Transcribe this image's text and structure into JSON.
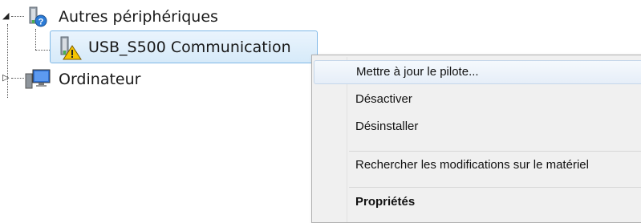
{
  "tree": {
    "nodes": [
      {
        "label": "Autres périphériques",
        "icon": "unknown-device-icon",
        "expanded": true
      },
      {
        "label": "USB_S500 Communication",
        "icon": "device-warning-icon",
        "selected": true
      },
      {
        "label": "Ordinateur",
        "icon": "computer-icon",
        "expanded": false
      }
    ]
  },
  "context_menu": {
    "items": [
      {
        "label": "Mettre à jour le pilote..."
      },
      {
        "label": "Désactiver"
      },
      {
        "label": "Désinstaller"
      },
      {
        "label": "Rechercher les modifications sur le matériel"
      },
      {
        "label": "Propriétés"
      }
    ]
  },
  "colors": {
    "selection_border": "#7fb8e6",
    "selection_fill": "#d6eaf9",
    "menu_background": "#f0f0f0"
  }
}
